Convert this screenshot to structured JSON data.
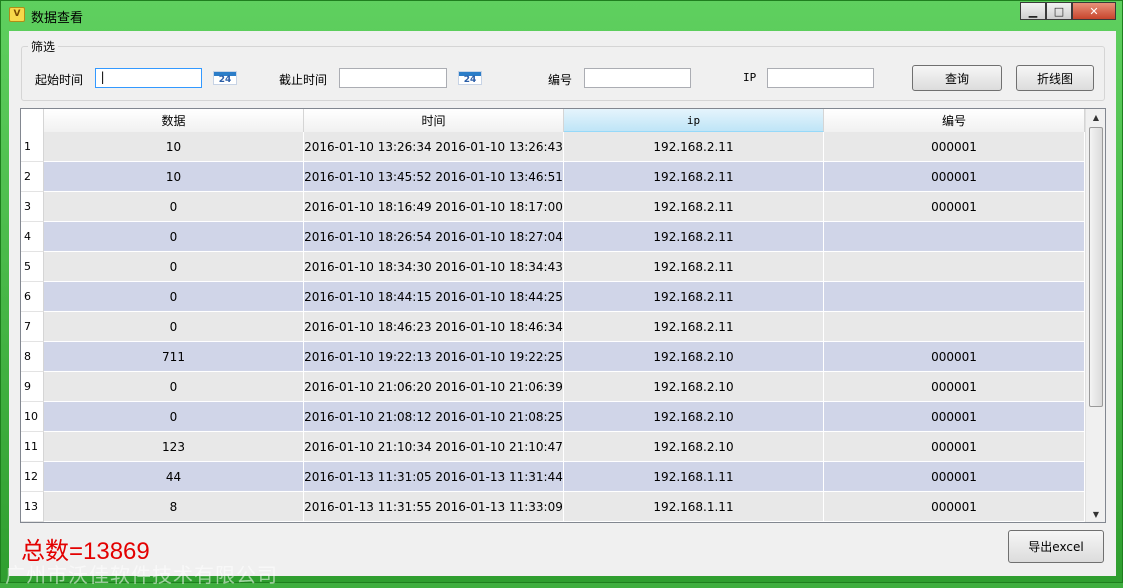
{
  "window": {
    "title": "数据查看",
    "icon": "app-icon",
    "min": "▁",
    "max": "□",
    "close": "✕"
  },
  "filter": {
    "group_label": "筛选",
    "start_label": "起始时间",
    "start_value": "|",
    "end_label": "截止时间",
    "end_value": "",
    "calendar_text": "24",
    "id_label": "编号",
    "id_value": "",
    "ip_label": "IP",
    "ip_value": "",
    "query_button": "查询",
    "chart_button": "折线图"
  },
  "table": {
    "columns": [
      "数据",
      "时间",
      "ip",
      "编号"
    ],
    "selected_column": 2,
    "rows": [
      {
        "n": "1",
        "data": "10",
        "time": "2016-01-10 13:26:34 2016-01-10 13:26:43",
        "ip": "192.168.2.11",
        "id": "000001"
      },
      {
        "n": "2",
        "data": "10",
        "time": "2016-01-10 13:45:52 2016-01-10 13:46:51",
        "ip": "192.168.2.11",
        "id": "000001"
      },
      {
        "n": "3",
        "data": "0",
        "time": "2016-01-10 18:16:49 2016-01-10 18:17:00",
        "ip": "192.168.2.11",
        "id": "000001"
      },
      {
        "n": "4",
        "data": "0",
        "time": "2016-01-10 18:26:54 2016-01-10 18:27:04",
        "ip": "192.168.2.11",
        "id": ""
      },
      {
        "n": "5",
        "data": "0",
        "time": "2016-01-10 18:34:30 2016-01-10 18:34:43",
        "ip": "192.168.2.11",
        "id": ""
      },
      {
        "n": "6",
        "data": "0",
        "time": "2016-01-10 18:44:15 2016-01-10 18:44:25",
        "ip": "192.168.2.11",
        "id": ""
      },
      {
        "n": "7",
        "data": "0",
        "time": "2016-01-10 18:46:23 2016-01-10 18:46:34",
        "ip": "192.168.2.11",
        "id": ""
      },
      {
        "n": "8",
        "data": "711",
        "time": "2016-01-10 19:22:13 2016-01-10 19:22:25",
        "ip": "192.168.2.10",
        "id": "000001"
      },
      {
        "n": "9",
        "data": "0",
        "time": "2016-01-10 21:06:20 2016-01-10 21:06:39",
        "ip": "192.168.2.10",
        "id": "000001"
      },
      {
        "n": "10",
        "data": "0",
        "time": "2016-01-10 21:08:12 2016-01-10 21:08:25",
        "ip": "192.168.2.10",
        "id": "000001"
      },
      {
        "n": "11",
        "data": "123",
        "time": "2016-01-10 21:10:34 2016-01-10 21:10:47",
        "ip": "192.168.2.10",
        "id": "000001"
      },
      {
        "n": "12",
        "data": "44",
        "time": "2016-01-13 11:31:05 2016-01-13 11:31:44",
        "ip": "192.168.1.11",
        "id": "000001"
      },
      {
        "n": "13",
        "data": "8",
        "time": "2016-01-13 11:31:55 2016-01-13 11:33:09",
        "ip": "192.168.1.11",
        "id": "000001"
      }
    ]
  },
  "footer": {
    "total": "总数=13869",
    "export_button": "导出excel",
    "watermark": "广州市沃佳软件技术有限公司"
  },
  "colors": {
    "window_frame": "#3fae3f",
    "row_alt": "#d0d5e8",
    "row": "#e8e8e8",
    "total_text": "#e30000"
  }
}
